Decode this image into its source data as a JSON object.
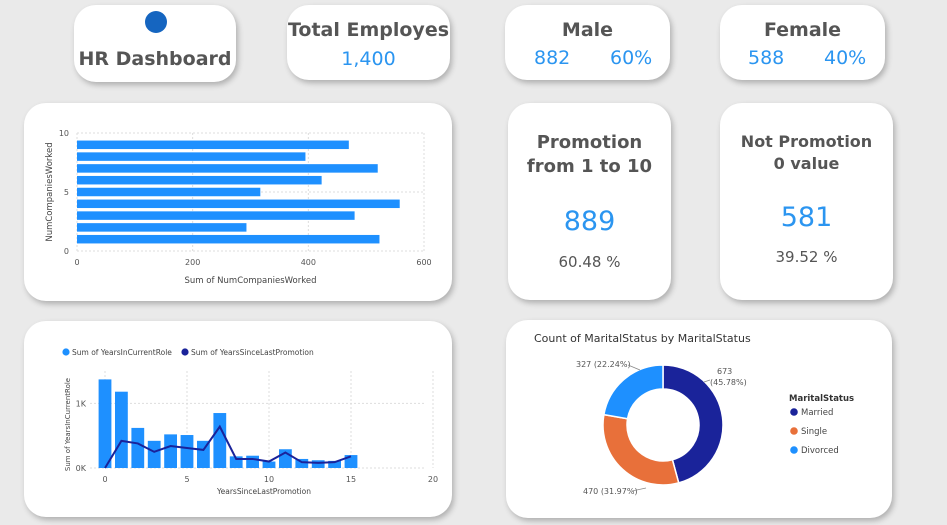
{
  "colors": {
    "accent": "#1e90ff",
    "navy": "#1a239a",
    "orange": "#e8703a",
    "kpi_blue": "#2b95f0"
  },
  "logo": {
    "title": "HR Dashboard"
  },
  "total": {
    "title": "Total Employes",
    "value": "1,400"
  },
  "male": {
    "title": "Male",
    "count": "882",
    "pct": "60%"
  },
  "female": {
    "title": "Female",
    "count": "588",
    "pct": "40%"
  },
  "promotion": {
    "line1": "Promotion",
    "line2": "from 1 to 10",
    "value": "889",
    "pct": "60.48 %"
  },
  "not_promotion": {
    "line1": "Not Promotion",
    "line2": "0 value",
    "value": "581",
    "pct": "39.52 %"
  },
  "chart_data": [
    {
      "type": "bar",
      "orientation": "horizontal",
      "xlabel": "Sum of NumCompaniesWorked",
      "ylabel": "NumCompaniesWorked",
      "x_ticks": [
        "0",
        "200",
        "400",
        "600"
      ],
      "y_ticks": [
        "0",
        "5",
        "10"
      ],
      "xlim": [
        0,
        600
      ],
      "ylim": [
        0,
        10
      ],
      "grid": true,
      "y": [
        9,
        8,
        7,
        6,
        5,
        4,
        3,
        2,
        1,
        0
      ],
      "values": [
        470,
        395,
        520,
        423,
        317,
        558,
        480,
        293,
        523,
        0
      ]
    },
    {
      "type": "bar+line",
      "xlabel": "YearsSinceLastPromotion",
      "ylabel": "Sum of YearsInCurrentRole",
      "x_ticks": [
        "0",
        "5",
        "10",
        "15",
        "20"
      ],
      "y_ticks": [
        "0K",
        "1K"
      ],
      "xlim": [
        0,
        20
      ],
      "ylim": [
        0,
        1500
      ],
      "grid": true,
      "legend_position": "top-left",
      "x": [
        0,
        1,
        2,
        3,
        4,
        5,
        6,
        7,
        8,
        9,
        10,
        11,
        12,
        13,
        14,
        15
      ],
      "series": [
        {
          "name": "Sum of YearsInCurrentRole",
          "values": [
            1370,
            1180,
            620,
            420,
            520,
            510,
            420,
            850,
            180,
            190,
            100,
            290,
            140,
            120,
            110,
            200
          ]
        },
        {
          "name": "Sum of YearsSinceLastPromotion",
          "values": [
            0,
            420,
            380,
            250,
            340,
            310,
            280,
            640,
            140,
            140,
            100,
            240,
            90,
            80,
            90,
            180
          ]
        }
      ]
    },
    {
      "type": "pie",
      "variant": "donut",
      "title": "Count of MaritalStatus by MaritalStatus",
      "legend_title": "MaritalStatus",
      "legend_position": "right",
      "slices": [
        {
          "label": "Married",
          "value": 673,
          "label_text": "673",
          "label_pct": "(45.78%)",
          "color": "#1a239a"
        },
        {
          "label": "Single",
          "value": 470,
          "label_text": "470 (31.97%)",
          "color": "#e8703a"
        },
        {
          "label": "Divorced",
          "value": 327,
          "label_text": "327 (22.24%)",
          "color": "#1e90ff"
        }
      ]
    }
  ]
}
